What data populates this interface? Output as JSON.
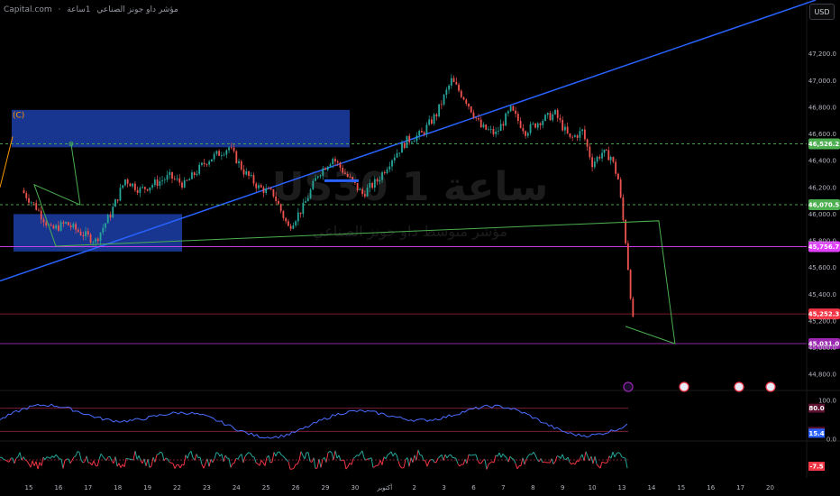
{
  "header": {
    "source": "Capital.com",
    "separator": "·",
    "title": "مؤشر داو جونز الصناعي",
    "timeframe": "1ساعة"
  },
  "currency": "USD",
  "watermark": {
    "symbol": "US30",
    "timeframe": "1 ساعة",
    "name": "مؤشر متوسط داو جونز الصناعي"
  },
  "wave_label": "(C)",
  "colors": {
    "up": "#26a69a",
    "down": "#ef5350",
    "trend": "#2962ff",
    "zone": "#1c3fa8",
    "green_level": "#4caf50",
    "magenta": "#e040fb",
    "red": "#f23645",
    "purple": "#9c27b0",
    "stoch": "#4a6cff",
    "osc_green": "#26a69a",
    "osc_red": "#f23645"
  },
  "chart_data": {
    "type": "line",
    "price_axis": {
      "ylim": [
        44700,
        47400
      ],
      "ticks": [
        44800,
        45000,
        45200,
        45400,
        45600,
        45800,
        46000,
        46200,
        46400,
        46600,
        46800,
        47000,
        47200
      ],
      "tick_labels": [
        "44,800.0",
        "45,000.0",
        "45,200.0",
        "45,400.0",
        "45,600.0",
        "45,800.0",
        "46,000.0",
        "46,200.0",
        "46,400.0",
        "46,600.0",
        "46,800.0",
        "47,000.0",
        "47,200.0"
      ]
    },
    "x_axis": {
      "labels": [
        "15",
        "16",
        "17",
        "18",
        "19",
        "22",
        "23",
        "24",
        "25",
        "26",
        "29",
        "30",
        "أكتوبر",
        "2",
        "3",
        "6",
        "7",
        "8",
        "9",
        "10",
        "13",
        "14",
        "15",
        "16",
        "17",
        "20"
      ]
    },
    "price_path": [
      [
        "15",
        46180
      ],
      [
        "15",
        46050
      ],
      [
        "16",
        45880
      ],
      [
        "16",
        45930
      ],
      [
        "17",
        45860
      ],
      [
        "17",
        45800
      ],
      [
        "18",
        46000
      ],
      [
        "18",
        46260
      ],
      [
        "19",
        46180
      ],
      [
        "19",
        46230
      ],
      [
        "22",
        46280
      ],
      [
        "22",
        46220
      ],
      [
        "23",
        46400
      ],
      [
        "24",
        46500
      ],
      [
        "24",
        46320
      ],
      [
        "25",
        46200
      ],
      [
        "25",
        46150
      ],
      [
        "26",
        45900
      ],
      [
        "26",
        46050
      ],
      [
        "29",
        46300
      ],
      [
        "29",
        46420
      ],
      [
        "30",
        46280
      ],
      [
        "30",
        46150
      ],
      [
        "أكتوبر",
        46250
      ],
      [
        "أكتوبر",
        46420
      ],
      [
        "2",
        46550
      ],
      [
        "2",
        46600
      ],
      [
        "3",
        46750
      ],
      [
        "3",
        47000
      ],
      [
        "6",
        46850
      ],
      [
        "6",
        46650
      ],
      [
        "7",
        46600
      ],
      [
        "7",
        46780
      ],
      [
        "8",
        46620
      ],
      [
        "8",
        46700
      ],
      [
        "9",
        46750
      ],
      [
        "9",
        46560
      ],
      [
        "10",
        46620
      ],
      [
        "10",
        46380
      ],
      [
        "10",
        46460
      ],
      [
        "13",
        46430
      ],
      [
        "13",
        46260
      ],
      [
        "13",
        45800
      ],
      [
        "13",
        45200
      ]
    ],
    "levels": [
      {
        "value": 46526.2,
        "label": "46,526.2",
        "color": "green"
      },
      {
        "value": 46070.5,
        "label": "46,070.5",
        "color": "green"
      },
      {
        "value": 45756.7,
        "label": "45,756.7",
        "color": "magenta"
      },
      {
        "value": 45252.3,
        "label": "45,252.3",
        "color": "red"
      },
      {
        "value": 45031.0,
        "label": "45,031.0",
        "color": "purple"
      }
    ],
    "zones": [
      {
        "from": "15",
        "to": "30",
        "low": 46500,
        "high": 46780
      },
      {
        "from": "15",
        "to": "22",
        "low": 45720,
        "high": 46000
      }
    ],
    "projection": [
      {
        "date": "13",
        "value": 45160
      },
      {
        "date": "14",
        "value": 45030
      },
      {
        "date": "14",
        "value": 45950
      },
      {
        "date": "15",
        "value": 45760
      },
      {
        "date": "15",
        "value": 46220
      },
      {
        "date": "16",
        "value": 46070
      },
      {
        "date": "16",
        "value": 46526.2
      }
    ],
    "events": [
      {
        "date": "13"
      },
      {
        "date": "14"
      },
      {
        "date": "16"
      },
      {
        "date": "17"
      }
    ],
    "stochastic": {
      "ylim": [
        0,
        100
      ],
      "ticks": [
        0,
        100
      ],
      "tick_labels": [
        "0.0",
        "100.0"
      ],
      "bands": [
        {
          "value": 80,
          "label": "80.0"
        },
        {
          "value": 20,
          "label": "20.0"
        }
      ],
      "current": {
        "value": 15.4,
        "label": "15.4"
      }
    },
    "oscillator": {
      "current": {
        "value": -7.5,
        "label": "-7.5"
      }
    }
  }
}
